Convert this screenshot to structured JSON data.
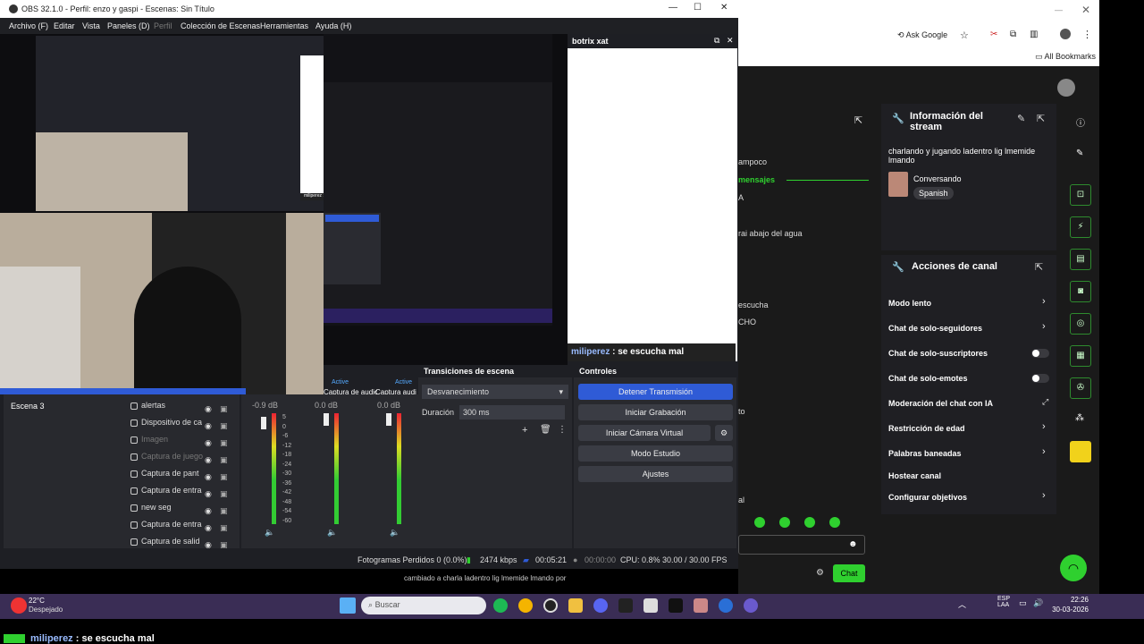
{
  "obs": {
    "title": "OBS 32.1.0 - Perfil: enzo y gaspi - Escenas: Sin Título",
    "menu": [
      "Archivo (F)",
      "Editar",
      "Vista",
      "Paneles (D)",
      "Perfil",
      "Colección de Escenas",
      "Herramientas",
      "Ayuda (H)"
    ],
    "chat_dock_title": "botrix xat",
    "scene": "Escena 3",
    "sources": [
      "alertas",
      "Dispositivo de ca",
      "Imagen",
      "Captura de juego",
      "Captura de pant",
      "Captura de entra",
      "new seg",
      "Captura de entra",
      "Captura de salid"
    ],
    "mixer": {
      "channels": [
        "-0.9 dB",
        "0.0 dB",
        "0.0 dB"
      ],
      "scale": [
        "5",
        "0",
        "-6",
        "-12",
        "-18",
        "-24",
        "-30",
        "-36",
        "-42",
        "-48",
        "-54",
        "-60"
      ]
    },
    "transitions": {
      "title": "Transiciones de escena",
      "type": "Desvanecimiento",
      "duration_label": "Duración",
      "duration": "300 ms"
    },
    "controls": {
      "title": "Controles",
      "buttons": [
        "Detener Transmisión",
        "Iniciar Grabación",
        "Iniciar Cámara Virtual",
        "Modo Estudio",
        "Ajustes"
      ]
    },
    "status": {
      "dropped": "Fotogramas Perdidos 0 (0.0%)",
      "kbps": "2474 kbps",
      "live_time": "00:05:21",
      "rec_time": "00:00:00",
      "cpu": "CPU: 0.8%",
      "fps": "30.00 / 30.00 FPS"
    },
    "chat_message": {
      "user": "miliperez",
      "text": " : se escucha mal"
    },
    "preview_mini_labels": {
      "active1": "Active",
      "active2": "Active",
      "cap1": "Captura de audio 3",
      "cap2": "Captura audi"
    }
  },
  "browser": {
    "ask_google": "Ask Google",
    "all_bookmarks": "All Bookmarks"
  },
  "stream_panel": {
    "info_title": "Información del stream",
    "stream_title": "charlando y jugando ladentro lig lmemide lmando",
    "category": "Conversando",
    "language": "Spanish",
    "actions_title": "Acciones de canal",
    "items": [
      "Modo lento",
      "Chat de solo-seguidores",
      "Chat de solo-suscriptores",
      "Chat de solo-emotes",
      "Moderación del chat con IA",
      "Restricción de edad",
      "Palabras baneadas",
      "Hostear canal",
      "Configurar objetivos"
    ],
    "partial_left": [
      "ampoco",
      "mensajes",
      "A",
      "rai abajo del agua",
      "escucha",
      "CHO",
      "to",
      "al"
    ],
    "chat_button": "Chat",
    "notification": "cambiado a charla ladentro lig lmemide lmando por"
  },
  "taskbar": {
    "weather_temp": "22°C",
    "weather_desc": "Despejado",
    "search_placeholder": "Buscar",
    "lang": "ESP",
    "lang2": "LAA",
    "time": "22:26",
    "date": "30-03-2026"
  },
  "overlay_chat": {
    "user": "miliperez",
    "text": " : se escucha mal"
  },
  "colors": {
    "accent_blue": "#2f5bd6",
    "green": "#2fd02f",
    "yellow": "#f1d21b",
    "taskbar": "#3a2d55"
  }
}
